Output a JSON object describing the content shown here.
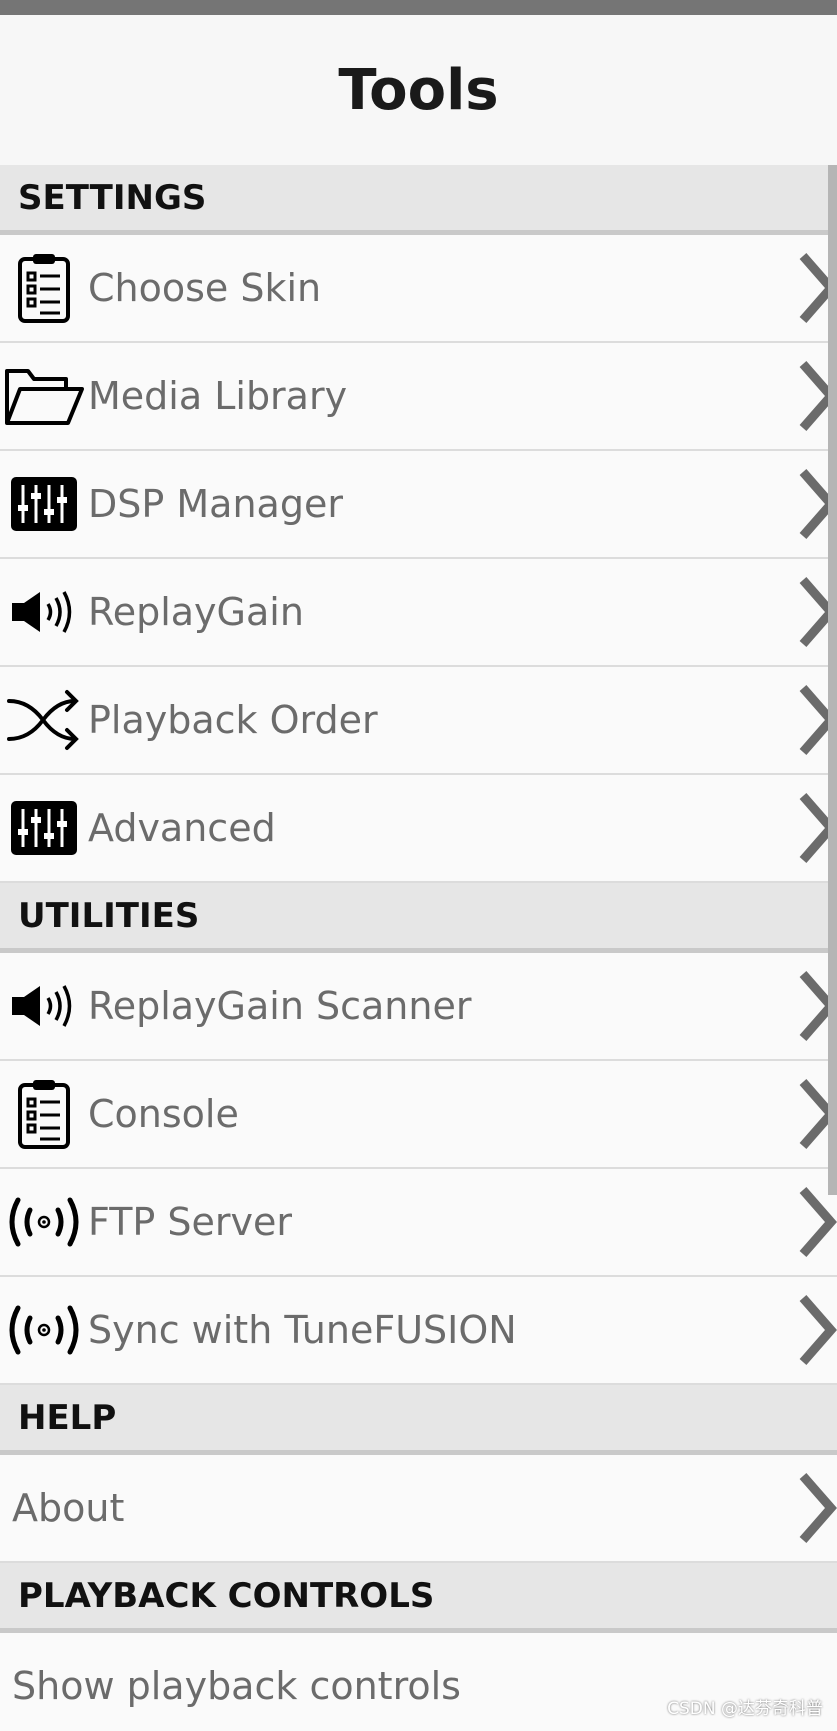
{
  "header": {
    "title": "Tools"
  },
  "sections": {
    "settings": {
      "title": "SETTINGS",
      "items": [
        {
          "label": "Choose Skin",
          "icon": "clipboard-list-icon"
        },
        {
          "label": "Media Library",
          "icon": "folder-open-icon"
        },
        {
          "label": "DSP Manager",
          "icon": "equalizer-sliders-icon"
        },
        {
          "label": "ReplayGain",
          "icon": "speaker-volume-icon"
        },
        {
          "label": "Playback Order",
          "icon": "shuffle-icon"
        },
        {
          "label": "Advanced",
          "icon": "equalizer-sliders-icon"
        }
      ]
    },
    "utilities": {
      "title": "UTILITIES",
      "items": [
        {
          "label": "ReplayGain Scanner",
          "icon": "speaker-volume-icon"
        },
        {
          "label": "Console",
          "icon": "clipboard-list-icon"
        },
        {
          "label": "FTP Server",
          "icon": "broadcast-icon"
        },
        {
          "label": "Sync with TuneFUSION",
          "icon": "broadcast-icon"
        }
      ]
    },
    "help": {
      "title": "HELP",
      "items": [
        {
          "label": "About"
        }
      ]
    },
    "playback": {
      "title": "PLAYBACK CONTROLS",
      "items": [
        {
          "label": "Show playback controls"
        }
      ]
    }
  },
  "watermark": "CSDN @达芬奇科普",
  "colors": {
    "topbar": "#757575",
    "section_bg": "#e6e6e6",
    "label": "#6b6b6b",
    "chevron": "#6b6b6b"
  }
}
